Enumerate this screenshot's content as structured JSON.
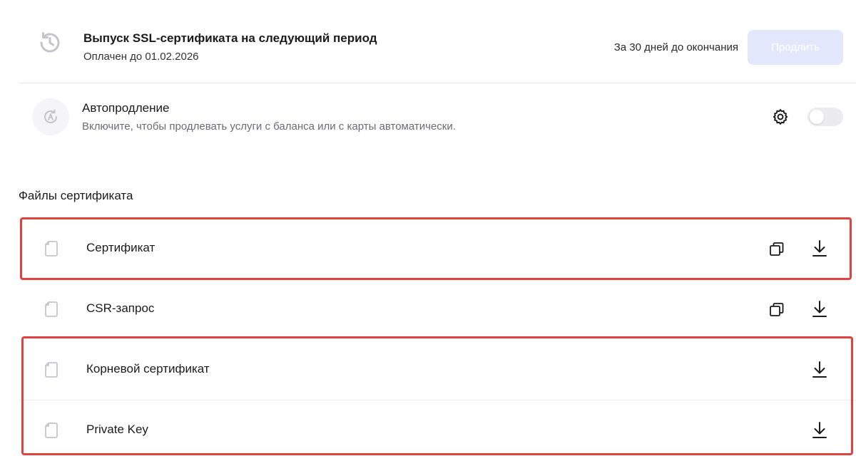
{
  "renewal": {
    "title": "Выпуск SSL-сертификата на следующий период",
    "paid_until": "Оплачен до 01.02.2026",
    "note": "За 30 дней до окончания",
    "button_label": "Продлить",
    "button_disabled": true,
    "icon": "history-clock-icon"
  },
  "autorenew": {
    "title": "Автопродление",
    "description": "Включите, чтобы продлевать услуги с баланса или с карты автоматически.",
    "enabled": false,
    "icon": "auto-renew-icon",
    "settings_icon": "gear-icon"
  },
  "files": {
    "heading": "Файлы сертификата",
    "items": [
      {
        "name": "Сертификат",
        "copy": true,
        "download": true,
        "highlighted": true
      },
      {
        "name": "CSR-запрос",
        "copy": true,
        "download": true,
        "highlighted": false
      },
      {
        "name": "Корневой сертификат",
        "copy": false,
        "download": true,
        "highlighted": true
      },
      {
        "name": "Private Key",
        "copy": false,
        "download": true,
        "highlighted": true
      }
    ]
  },
  "colors": {
    "accent_disabled": "#e3e7fb",
    "highlight": "#e0433f",
    "muted_text": "#6b6b73",
    "icon_gray": "#c4c4cc"
  }
}
